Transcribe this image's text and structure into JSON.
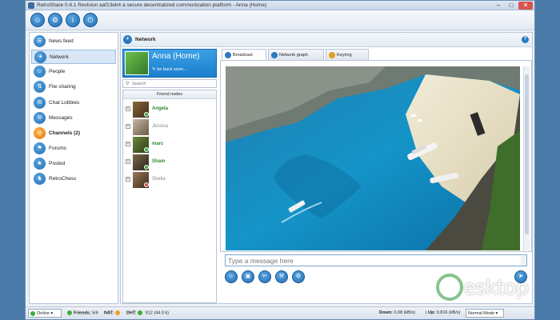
{
  "window": {
    "title": "RetroShare 0.6.1 Revision aaf13eb4 a secure decentralized communication platform - Anna (Home)",
    "minimize": "–",
    "maximize": "□",
    "close": "✕"
  },
  "toolbar": {
    "buttons": [
      {
        "icon": "add-friend-icon",
        "glyph": "☺"
      },
      {
        "icon": "gear-icon",
        "glyph": "⚙"
      },
      {
        "icon": "info-icon",
        "glyph": "i"
      },
      {
        "icon": "power-icon",
        "glyph": "⏻"
      }
    ]
  },
  "sidebar": {
    "items": [
      {
        "label": "News feed",
        "icon": "news-feed-icon",
        "glyph": "☰"
      },
      {
        "label": "Network",
        "icon": "network-icon",
        "glyph": "✈",
        "active": true
      },
      {
        "label": "People",
        "icon": "people-icon",
        "glyph": "☺"
      },
      {
        "label": "File sharing",
        "icon": "file-sharing-icon",
        "glyph": "⇅"
      },
      {
        "label": "Chat Lobbies",
        "icon": "chat-lobbies-icon",
        "glyph": "✉"
      },
      {
        "label": "Messages",
        "icon": "messages-icon",
        "glyph": "✉"
      },
      {
        "label": "Channels (2)",
        "icon": "channels-icon",
        "glyph": "◎",
        "highlight": true
      },
      {
        "label": "Forums",
        "icon": "forums-icon",
        "glyph": "⚑"
      },
      {
        "label": "Posted",
        "icon": "posted-icon",
        "glyph": "★"
      },
      {
        "label": "RetroChess",
        "icon": "retrochess-icon",
        "glyph": "♞"
      }
    ]
  },
  "main": {
    "title": "Network",
    "help": "?"
  },
  "profile": {
    "name": "Anna (Home)",
    "status": "be back soon..."
  },
  "search": {
    "placeholder": "Search"
  },
  "friends": {
    "header": "Friend nodes",
    "items": [
      {
        "name": "Angela",
        "state": "online"
      },
      {
        "name": "Jessica",
        "state": "offline"
      },
      {
        "name": "marc",
        "state": "online"
      },
      {
        "name": "Sham",
        "state": "online"
      },
      {
        "name": "Sheila",
        "state": "offline"
      }
    ]
  },
  "tabs": [
    {
      "label": "Broadcast",
      "active": true
    },
    {
      "label": "Network graph"
    },
    {
      "label": "Keyring"
    }
  ],
  "chat": {
    "placeholder": "Type a message here",
    "tools": [
      {
        "icon": "emoticon-icon",
        "glyph": "☺"
      },
      {
        "icon": "image-icon",
        "glyph": "▣"
      },
      {
        "icon": "attach-icon",
        "glyph": "✂"
      },
      {
        "icon": "wrench-icon",
        "glyph": "⚒"
      },
      {
        "icon": "settings-icon",
        "glyph": "⚙"
      }
    ],
    "send_glyph": "➤"
  },
  "status": {
    "online": "Online",
    "friends_label": "Friends:",
    "friends_value": "5/6",
    "nat_label": "NAT:",
    "dht_label": "DHT:",
    "dht_value": "912",
    "dht_extra": "(44.0 k)",
    "down_label": "Down:",
    "down_value": "0.08 (kB/s)",
    "up_label": "Up:",
    "up_value": "0.816 (kB/s)",
    "mode": "Normal Mode"
  },
  "watermark": {
    "text": "esktop"
  }
}
